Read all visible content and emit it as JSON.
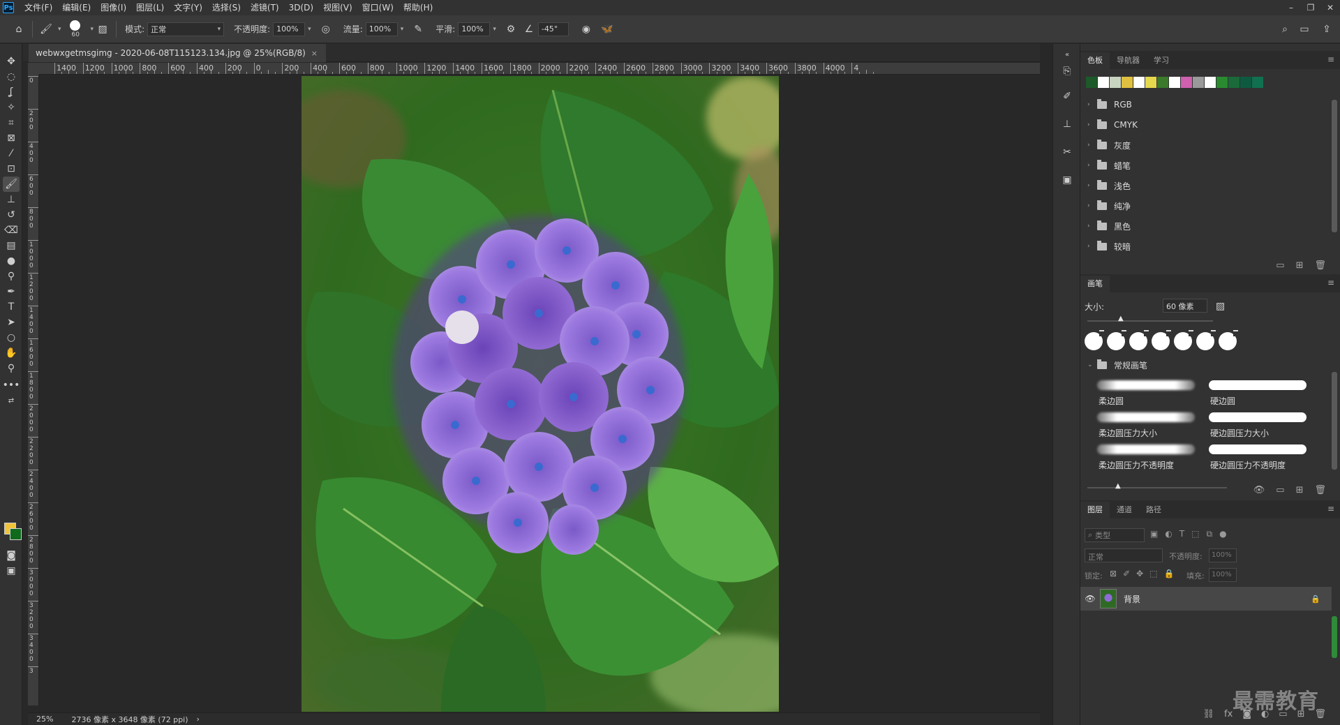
{
  "app": {
    "logo": "Ps"
  },
  "menu": [
    "文件(F)",
    "编辑(E)",
    "图像(I)",
    "图层(L)",
    "文字(Y)",
    "选择(S)",
    "滤镜(T)",
    "3D(D)",
    "视图(V)",
    "窗口(W)",
    "帮助(H)"
  ],
  "window_controls": {
    "minimize": "–",
    "restore": "❐",
    "close": "✕"
  },
  "options": {
    "brush_size": "60",
    "mode_label": "模式:",
    "mode_value": "正常",
    "opacity_label": "不透明度:",
    "opacity_value": "100%",
    "flow_label": "流量:",
    "flow_value": "100%",
    "smooth_label": "平滑:",
    "smooth_value": "100%",
    "angle_value": "-45°"
  },
  "document": {
    "tab_title": "webwxgetmsgimg - 2020-06-08T115123.134.jpg @ 25%(RGB/8)",
    "tab_close": "×",
    "zoom": "25%",
    "dimensions": "2736 像素 x 3648 像素 (72 ppi)",
    "status_arrow": "›"
  },
  "ruler_h": [
    "1400",
    "1200",
    "1000",
    "800",
    "600",
    "400",
    "200",
    "0",
    "200",
    "400",
    "600",
    "800",
    "1000",
    "1200",
    "1400",
    "1600",
    "1800",
    "2000",
    "2200",
    "2400",
    "2600",
    "2800",
    "3000",
    "3200",
    "3400",
    "3600",
    "3800",
    "4000",
    "4"
  ],
  "ruler_v": [
    "0",
    "2 0 0",
    "4 0 0",
    "6 0 0",
    "8 0 0",
    "1 0 0 0",
    "1 2 0 0",
    "1 4 0 0",
    "1 6 0 0",
    "1 8 0 0",
    "2 0 0 0",
    "2 2 0 0",
    "2 4 0 0",
    "2 6 0 0",
    "2 8 0 0",
    "3 0 0 0",
    "3 2 0 0",
    "3 4 0 0",
    "3"
  ],
  "swatches_panel": {
    "tabs": [
      "色板",
      "导航器",
      "学习"
    ],
    "colors": [
      "#1d5a2a",
      "#ffffff",
      "#c8d4c0",
      "#e0c040",
      "#ffffff",
      "#e6d84c",
      "#3a7a2a",
      "#ffffff",
      "#d060b0",
      "#9a9a9a",
      "#ffffff",
      "#2a8a30",
      "#1a6a3a",
      "#0e5a40",
      "#107050"
    ],
    "folders": [
      "RGB",
      "CMYK",
      "灰度",
      "蜡笔",
      "浅色",
      "纯净",
      "黑色",
      "较暗"
    ]
  },
  "brushes_panel": {
    "tab": "画笔",
    "size_label": "大小:",
    "size_value": "60 像素",
    "group": "常规画笔",
    "brushes": [
      "柔边圆",
      "硬边圆",
      "柔边圆压力大小",
      "硬边圆压力大小",
      "柔边圆压力不透明度",
      "硬边圆压力不透明度"
    ]
  },
  "layers_panel": {
    "tabs": [
      "图层",
      "通道",
      "路径"
    ],
    "search_placeholder": "类型",
    "blend_mode": "正常",
    "opacity_label": "不透明度:",
    "opacity_value": "100%",
    "lock_label": "锁定:",
    "fill_label": "填充:",
    "fill_value": "100%",
    "layers": [
      {
        "name": "背景",
        "visible": true,
        "locked": true
      }
    ]
  },
  "watermark": "最需教育"
}
